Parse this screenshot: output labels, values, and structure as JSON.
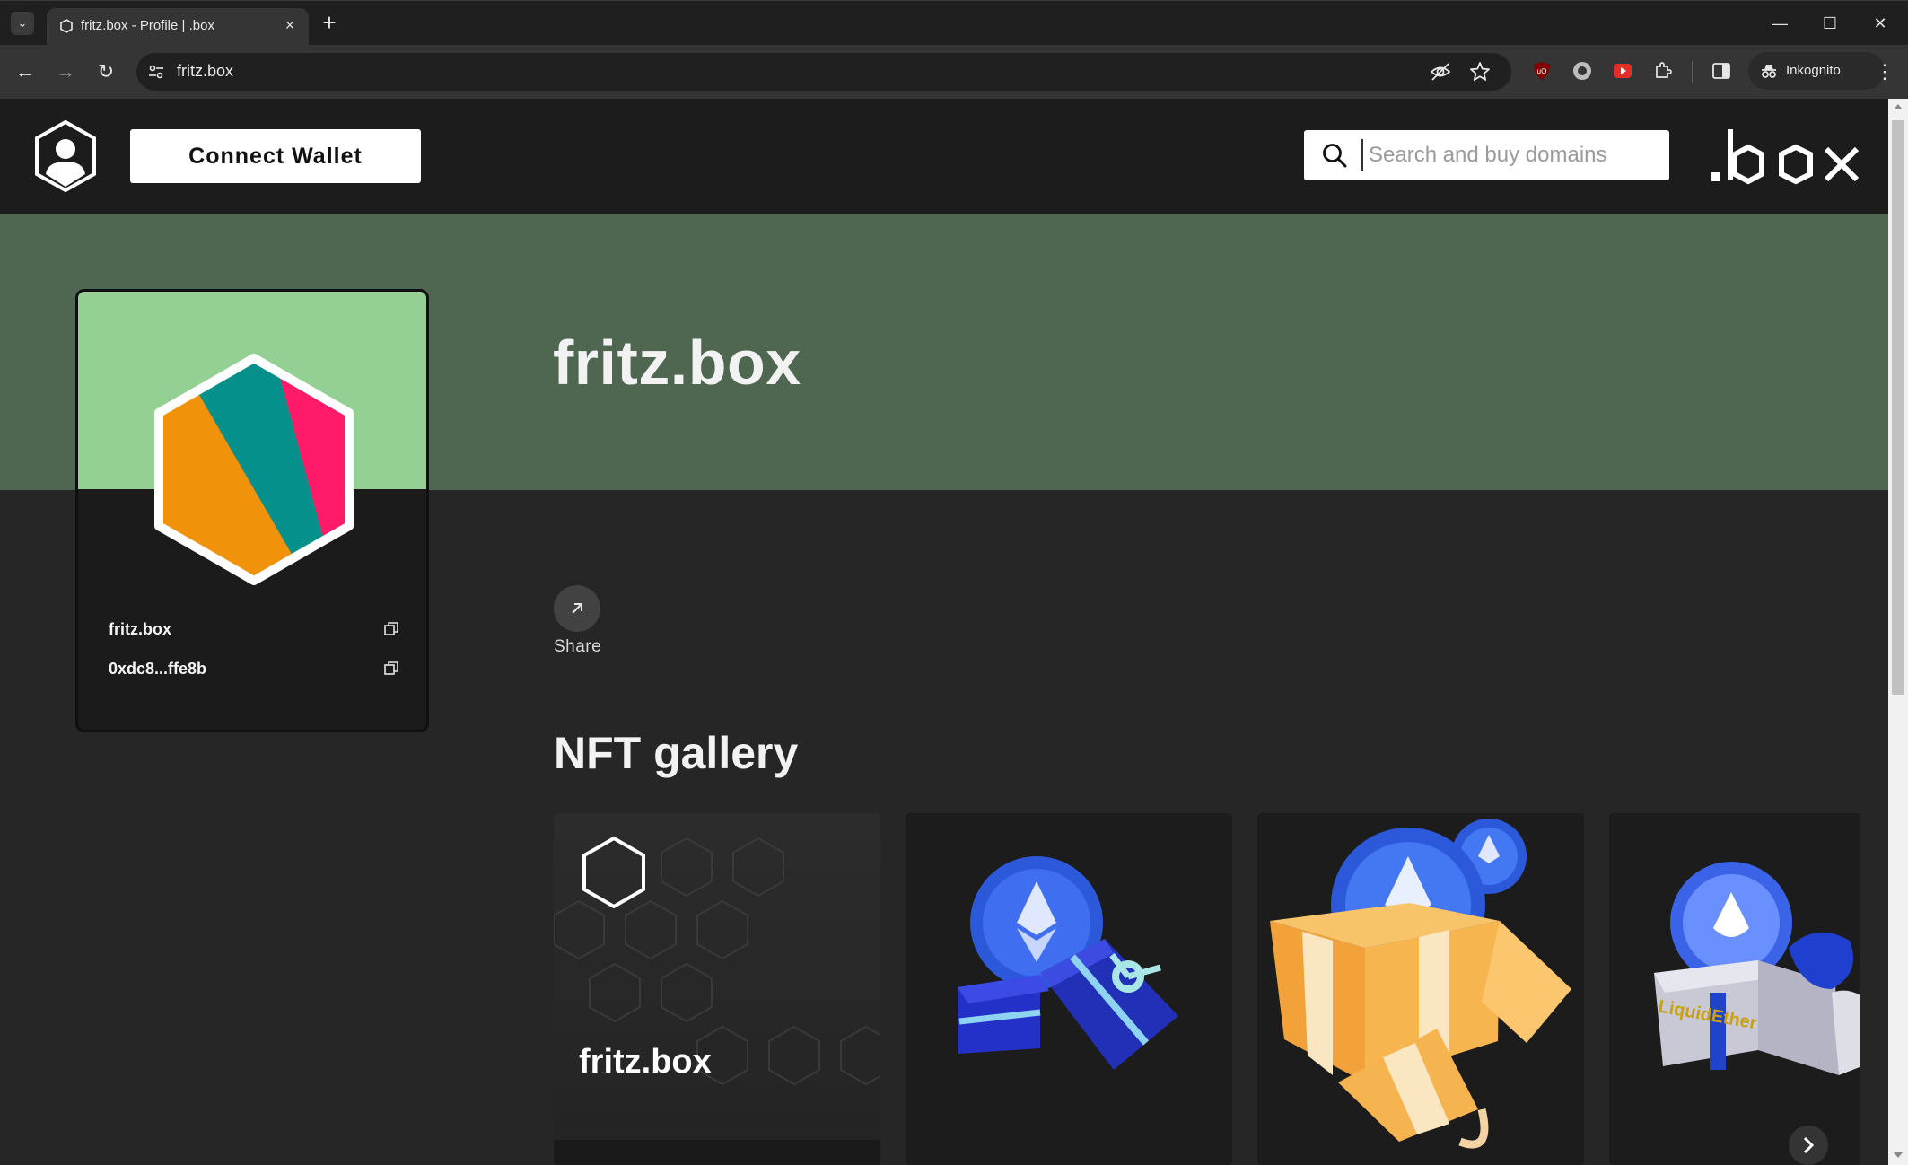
{
  "browser": {
    "tab_title": "fritz.box - Profile | .box",
    "url": "fritz.box",
    "profile_label": "Inkognito"
  },
  "header": {
    "connect_label": "Connect Wallet",
    "search_placeholder": "Search and buy domains",
    "brand": ".box"
  },
  "profile": {
    "domain": "fritz.box",
    "address": "0xdc8...ffe8b"
  },
  "main": {
    "title": "fritz.box",
    "share_label": "Share",
    "gallery_title": "NFT gallery"
  },
  "gallery": {
    "items": [
      {
        "label": "fritz.box",
        "art": "hexagon-pattern"
      },
      {
        "label": "",
        "art": "eth-coin-blue-gift"
      },
      {
        "label": "",
        "art": "eth-coins-orange-gift"
      },
      {
        "label": "LiquidEther",
        "art": "liquid-ether-gift"
      }
    ]
  },
  "colors": {
    "banner": "#4f6650",
    "card_top": "#94cf94",
    "hex_orange": "#f0920a",
    "hex_teal": "#05908c",
    "hex_pink": "#ff1a6a",
    "header_bg": "#1c1c1c",
    "page_bg": "#262626"
  }
}
